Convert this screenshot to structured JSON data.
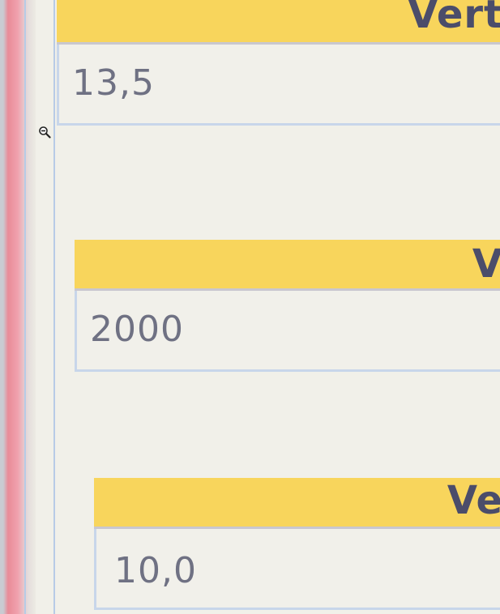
{
  "cards": [
    {
      "header_label": "Vert",
      "value": "13,5"
    },
    {
      "header_label": "V",
      "value": "2000"
    },
    {
      "header_label": "Ve",
      "value": "10,0"
    }
  ],
  "icons": {
    "zoom_out": "zoom-out-icon"
  },
  "colors": {
    "header_yellow": "#f8d55c",
    "value_text": "#6f7183",
    "border_blue": "#c8d6ea"
  }
}
